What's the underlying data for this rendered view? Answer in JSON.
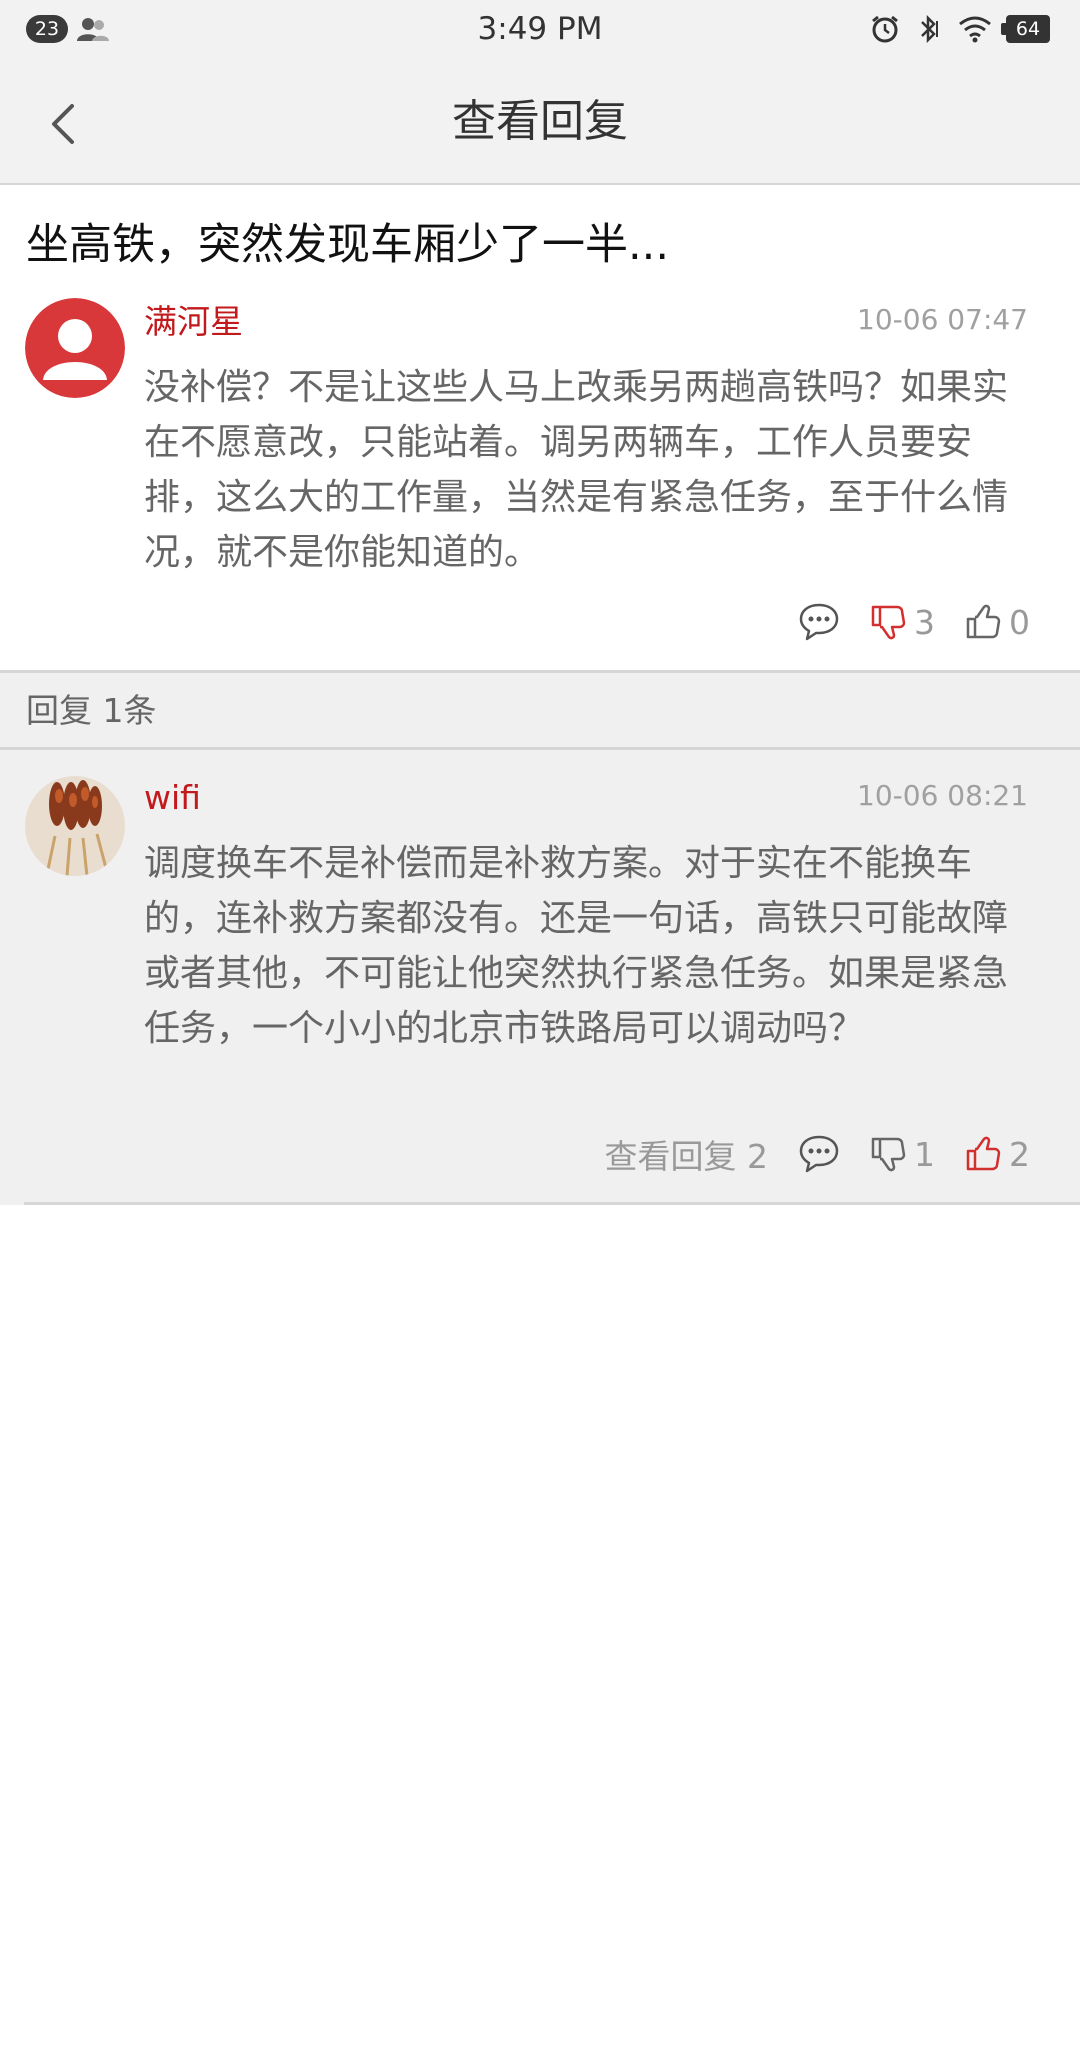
{
  "status_bar": {
    "notification_count": "23",
    "time": "3:49 PM",
    "battery": "64",
    "icons": [
      "people-icon",
      "alarm-icon",
      "bluetooth-icon",
      "wifi-icon",
      "battery-icon"
    ]
  },
  "nav": {
    "title": "查看回复",
    "back_icon": "chevron-left-icon"
  },
  "post": {
    "title": "坐高铁，突然发现车厢少了一半..."
  },
  "main_comment": {
    "username": "满河星",
    "timestamp": "10-06 07:47",
    "text": "没补偿？不是让这些人马上改乘另两趟高铁吗？如果实在不愿意改，只能站着。调另两辆车，工作人员要安排，这么大的工作量，当然是有紧急任务，至于什么情况，就不是你能知道的。",
    "dislikes": "3",
    "likes": "0",
    "dislike_active": true
  },
  "replies_header": {
    "label": "回复 1条"
  },
  "reply": {
    "username": "wifi",
    "timestamp": "10-06 08:21",
    "text": "调度换车不是补偿而是补救方案。对于实在不能换车的，连补救方案都没有。还是一句话，高铁只可能故障或者其他，不可能让他突然执行紧急任务。如果是紧急任务，一个小小的北京市铁路局可以调动吗？",
    "view_replies": "查看回复 2",
    "dislikes": "1",
    "likes": "2",
    "like_active": true
  },
  "colors": {
    "accent_red": "#c2191c",
    "gray_text": "#999999",
    "band_bg": "#f0f0f0"
  }
}
